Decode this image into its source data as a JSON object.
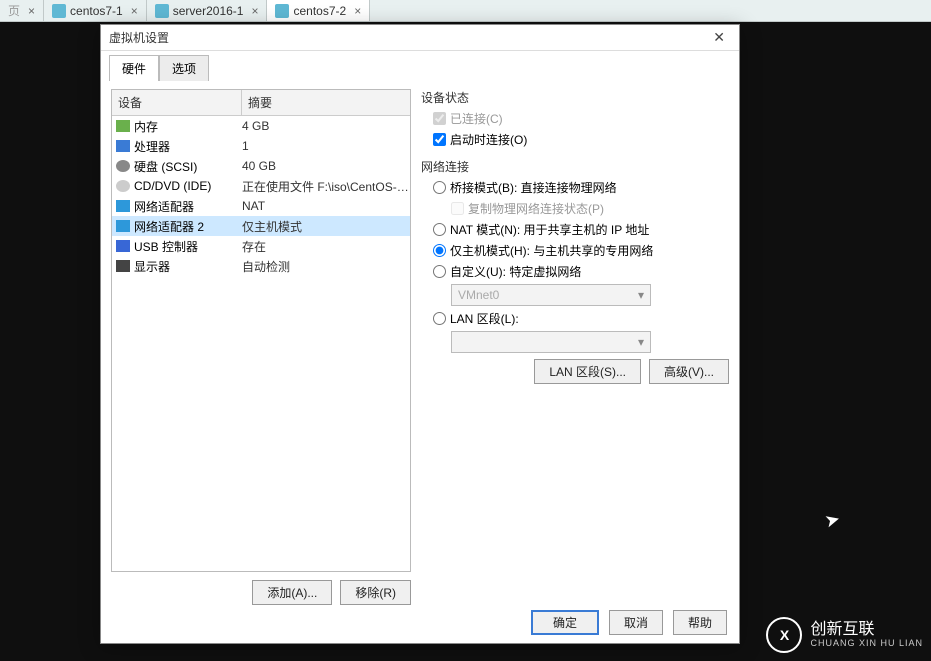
{
  "tabs_top": [
    {
      "label": "页",
      "close": true,
      "partial": true
    },
    {
      "label": "centos7-1",
      "close": true,
      "icon": true
    },
    {
      "label": "server2016-1",
      "close": true,
      "icon": true
    },
    {
      "label": "centos7-2",
      "close": true,
      "icon": true
    }
  ],
  "dialog": {
    "title": "虚拟机设置",
    "close": "✕",
    "tabs": {
      "hardware": "硬件",
      "options": "选项"
    },
    "headers": {
      "device": "设备",
      "summary": "摘要"
    },
    "devices": [
      {
        "name": "内存",
        "summary": "4 GB",
        "icon": "ic-mem"
      },
      {
        "name": "处理器",
        "summary": "1",
        "icon": "ic-cpu"
      },
      {
        "name": "硬盘 (SCSI)",
        "summary": "40 GB",
        "icon": "ic-hdd"
      },
      {
        "name": "CD/DVD (IDE)",
        "summary": "正在使用文件 F:\\iso\\CentOS-7-...",
        "icon": "ic-cd"
      },
      {
        "name": "网络适配器",
        "summary": "NAT",
        "icon": "ic-net"
      },
      {
        "name": "网络适配器 2",
        "summary": "仅主机模式",
        "icon": "ic-net",
        "selected": true
      },
      {
        "name": "USB 控制器",
        "summary": "存在",
        "icon": "ic-usb"
      },
      {
        "name": "显示器",
        "summary": "自动检测",
        "icon": "ic-disp"
      }
    ],
    "add_btn": "添加(A)...",
    "remove_btn": "移除(R)",
    "device_state": {
      "title": "设备状态",
      "connected": "已连接(C)",
      "connect_at_power": "启动时连接(O)"
    },
    "network": {
      "title": "网络连接",
      "bridged": "桥接模式(B): 直接连接物理网络",
      "replicate": "复制物理网络连接状态(P)",
      "nat": "NAT 模式(N): 用于共享主机的 IP 地址",
      "hostonly": "仅主机模式(H): 与主机共享的专用网络",
      "custom": "自定义(U): 特定虚拟网络",
      "vmnet": "VMnet0",
      "lan": "LAN 区段(L):",
      "lan_value": ""
    },
    "right_buttons": {
      "lan_seg": "LAN 区段(S)...",
      "advanced": "高级(V)..."
    },
    "bottom": {
      "ok": "确定",
      "cancel": "取消",
      "help": "帮助"
    }
  },
  "watermark": {
    "brand": "创新互联",
    "sub": "CHUANG XIN HU LIAN",
    "logo": "X"
  }
}
